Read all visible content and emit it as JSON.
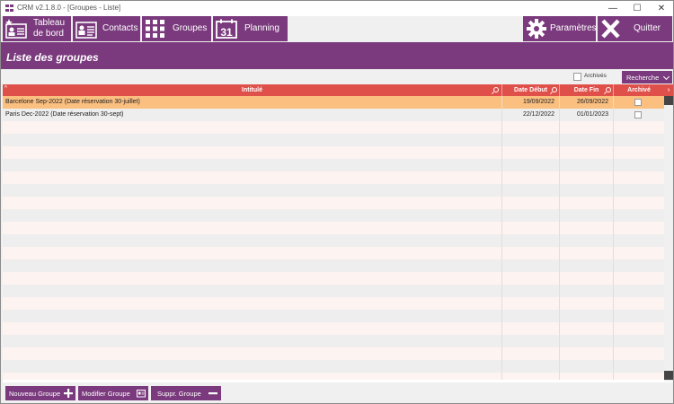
{
  "window": {
    "title": "CRM v2.1.8.0 - [Groupes - Liste]",
    "controls": {
      "minimize": "—",
      "maximize": "☐",
      "close": "✕"
    }
  },
  "toolbar": {
    "dashboard_label_line1": "Tableau",
    "dashboard_label_line2": "de bord",
    "contacts_label": "Contacts",
    "groups_label": "Groupes",
    "planning_label": "Planning",
    "planning_icon_text": "31",
    "settings_label": "Paramètres",
    "quit_label": "Quitter"
  },
  "page": {
    "title": "Liste des groupes"
  },
  "filters": {
    "archived_label": "Archivés",
    "search_label": "Recherche"
  },
  "grid": {
    "columns": {
      "title": "Intitulé",
      "start": "Date Début",
      "end": "Date Fin",
      "archived": "Archivé"
    },
    "rows": [
      {
        "title": "Barcelone Sep-2022 (Date réservation 30-juillet)",
        "start": "19/09/2022",
        "end": "26/09/2022",
        "archived": false,
        "selected": true
      },
      {
        "title": "Paris Dec-2022 (Date réservation 30-sept)",
        "start": "22/12/2022",
        "end": "01/01/2023",
        "archived": false,
        "selected": false
      }
    ]
  },
  "actions": {
    "new_label": "Nouveau Groupe",
    "edit_label": "Modifier Groupe",
    "delete_label": "Suppr. Groupe"
  },
  "colors": {
    "brand": "#7a3a7d",
    "grid_header": "#e0504b",
    "selected_row": "#fbbf80",
    "row_alt_a": "#fdf3f1",
    "row_alt_b": "#eeeeee"
  }
}
